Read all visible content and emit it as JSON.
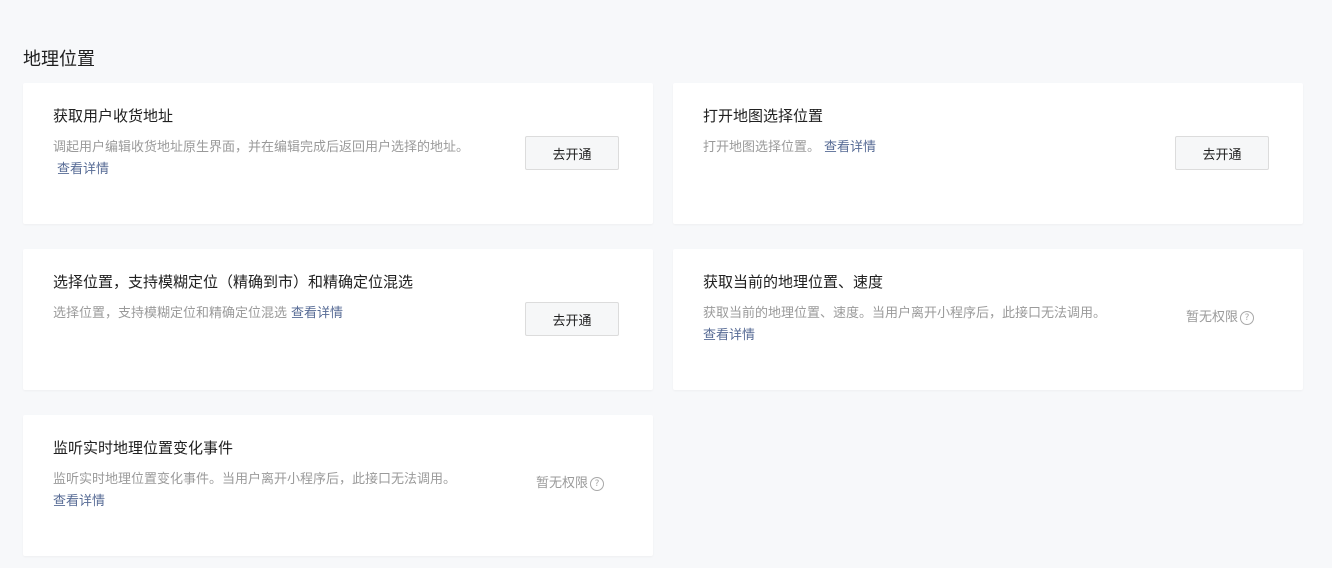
{
  "section": {
    "title": "地理位置"
  },
  "cards": [
    {
      "title": "获取用户收货地址",
      "description": "调起用户编辑收货地址原生界面，并在编辑完成后返回用户选择的地址。",
      "detail_link": "查看详情",
      "action": "去开通"
    },
    {
      "title": "打开地图选择位置",
      "description": "打开地图选择位置。",
      "detail_link": "查看详情",
      "action": "去开通"
    },
    {
      "title": "选择位置，支持模糊定位（精确到市）和精确定位混选",
      "description": "选择位置，支持模糊定位和精确定位混选",
      "detail_link": "查看详情",
      "action": "去开通"
    },
    {
      "title": "获取当前的地理位置、速度",
      "description": "获取当前的地理位置、速度。当用户离开小程序后，此接口无法调用。",
      "detail_link": "查看详情",
      "status": "暂无权限"
    },
    {
      "title": "监听实时地理位置变化事件",
      "description": "监听实时地理位置变化事件。当用户离开小程序后，此接口无法调用。",
      "detail_link": "查看详情",
      "status": "暂无权限"
    }
  ],
  "icons": {
    "help": "question-circle-icon"
  }
}
